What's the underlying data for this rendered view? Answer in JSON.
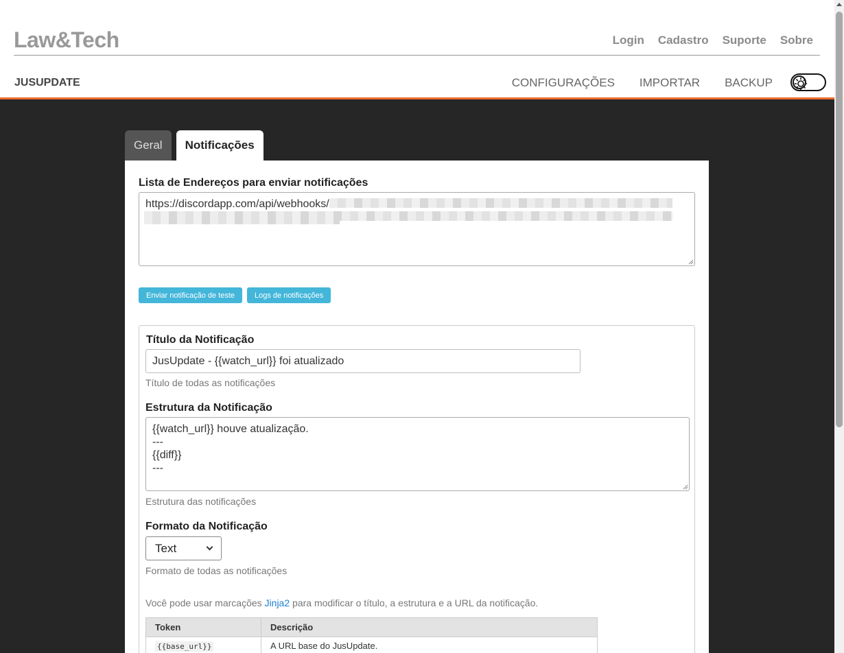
{
  "header": {
    "brand": "Law&Tech",
    "links": [
      "Login",
      "Cadastro",
      "Suporte",
      "Sobre"
    ],
    "app_name": "JUSUPDATE",
    "menu": [
      "CONFIGURAÇÕES",
      "IMPORTAR",
      "BACKUP"
    ]
  },
  "tabs": [
    {
      "label": "Geral",
      "active": false
    },
    {
      "label": "Notificações",
      "active": true
    }
  ],
  "notifications": {
    "urls_label": "Lista de Endereços para enviar notificações",
    "urls_value": "https://discordapp.com/api/webhooks/",
    "test_button": "Enviar notificação de teste",
    "logs_button": "Logs de notificações",
    "title_label": "Título da Notificação",
    "title_value": "JusUpdate - {{watch_url}} foi atualizado",
    "title_help": "Título de todas as notificações",
    "body_label": "Estrutura da Notificação",
    "body_lines": [
      "{{watch_url}} houve atualização.",
      "---",
      "{{diff}}",
      "---"
    ],
    "body_help": "Estrutura das notificações",
    "format_label": "Formato da Notificação",
    "format_value": "Text",
    "format_help": "Formato de todas as notificações",
    "info_prefix": "Você pode usar marcações ",
    "info_link": "Jinja2",
    "info_suffix": " para modificar o título, a estrutura e a URL da notificação."
  },
  "token_table": {
    "headers": [
      "Token",
      "Descrição"
    ],
    "rows": [
      {
        "token": "{{base_url}}",
        "description": "A URL base do JusUpdate."
      }
    ]
  },
  "colors": {
    "accent": "#ed6a2c",
    "button": "#43b6d9",
    "background": "#262626"
  }
}
